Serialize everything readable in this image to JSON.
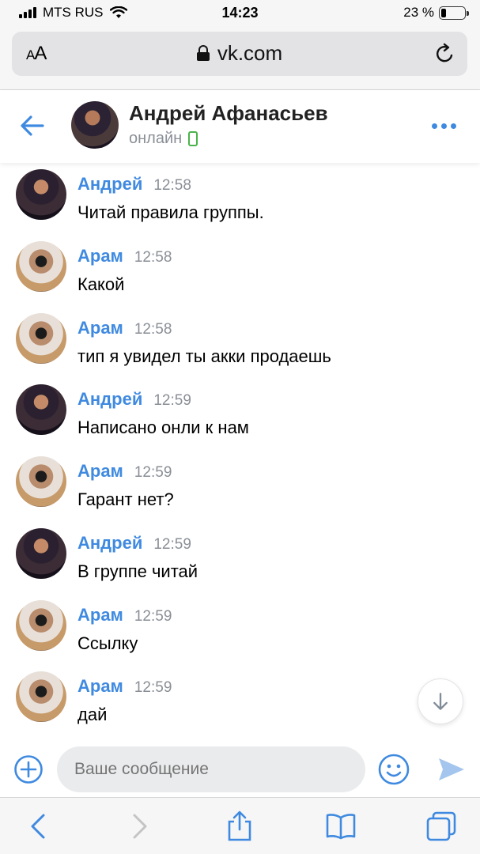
{
  "status_bar": {
    "carrier": "MTS RUS",
    "time": "14:23",
    "battery": "23 %",
    "battery_level": 0.23
  },
  "browser": {
    "aa_label_small": "A",
    "aa_label_big": "A",
    "url": "vk.com"
  },
  "chat": {
    "name": "Андрей Афанасьев",
    "status": "онлайн"
  },
  "messages": [
    {
      "author": "Андрей",
      "time": "12:58",
      "text": "Читай правила группы.",
      "avatar": "andrey"
    },
    {
      "author": "Арам",
      "time": "12:58",
      "text": "Какой",
      "avatar": "aram"
    },
    {
      "author": "Арам",
      "time": "12:58",
      "text": "тип я увидел ты акки продаешь",
      "avatar": "aram"
    },
    {
      "author": "Андрей",
      "time": "12:59",
      "text": "Написано онли к нам",
      "avatar": "andrey"
    },
    {
      "author": "Арам",
      "time": "12:59",
      "text": "Гарант нет?",
      "avatar": "aram"
    },
    {
      "author": "Андрей",
      "time": "12:59",
      "text": "В группе читай",
      "avatar": "andrey"
    },
    {
      "author": "Арам",
      "time": "12:59",
      "text": "Ссылку",
      "avatar": "aram"
    },
    {
      "author": "Арам",
      "time": "12:59",
      "text": "дай",
      "avatar": "aram"
    }
  ],
  "composer": {
    "placeholder": "Ваше сообщение"
  },
  "colors": {
    "accent": "#3f8ae0",
    "online": "#4bb34b"
  },
  "icons": [
    "back-arrow-icon",
    "more-icon",
    "lock-icon",
    "reload-icon",
    "add-icon",
    "emoji-icon",
    "send-icon",
    "arrow-down-icon",
    "share-icon",
    "bookmarks-icon",
    "tabs-icon"
  ]
}
